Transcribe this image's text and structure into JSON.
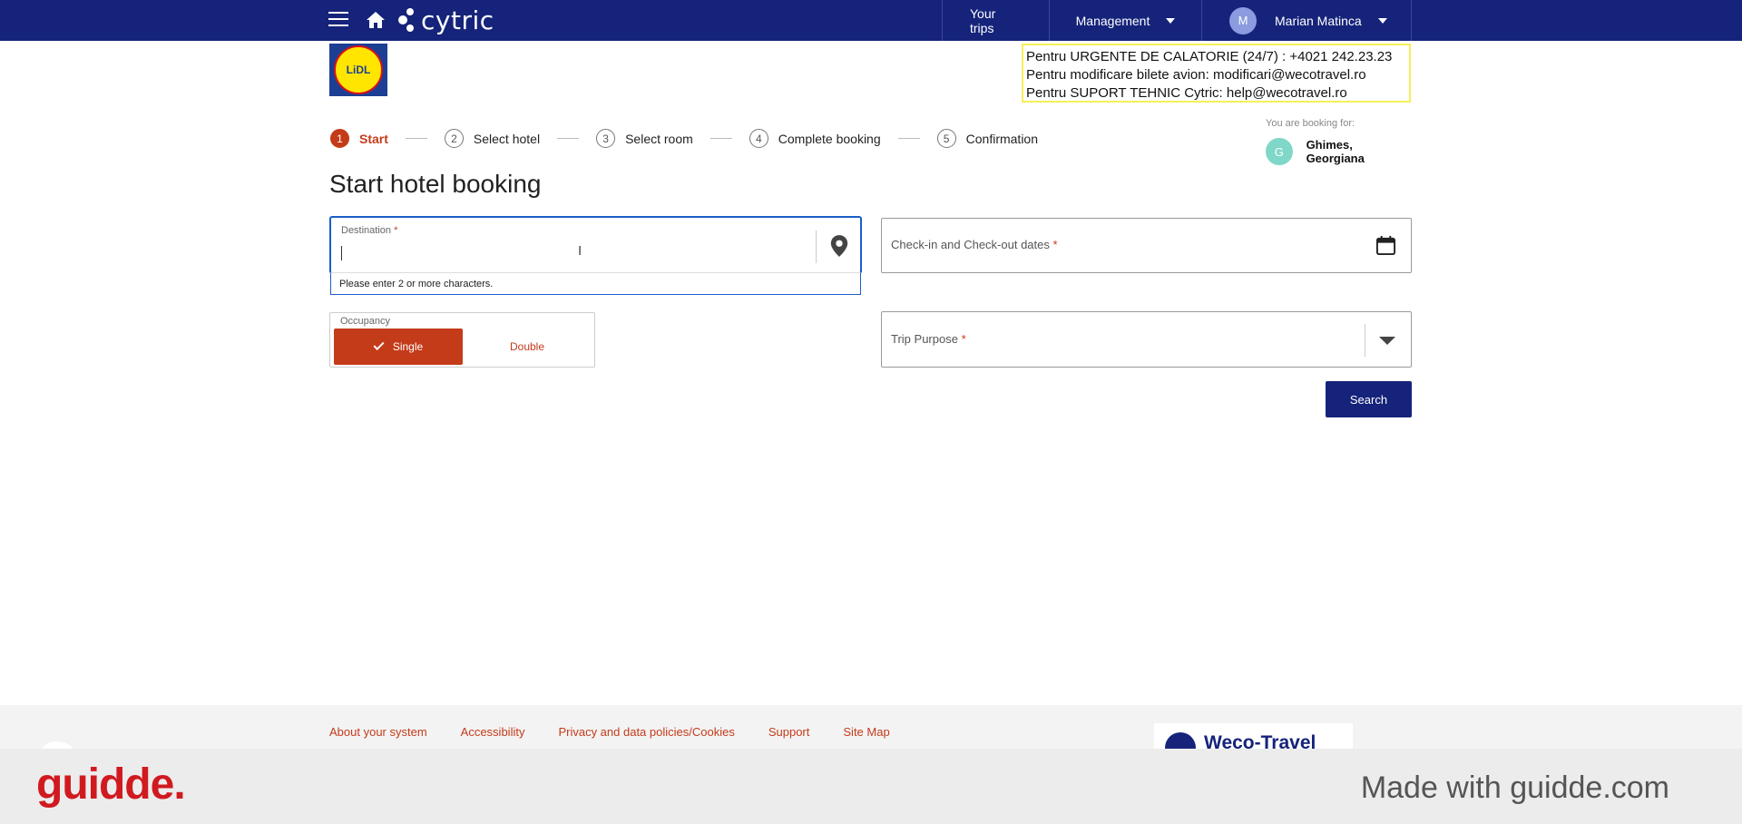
{
  "topbar": {
    "logo_text": "cytric",
    "nav": {
      "your_trips": "Your trips",
      "management": "Management",
      "user_initial": "M",
      "user_name": "Marian Matinca"
    }
  },
  "company_logo_text": "LiDL",
  "emergency": {
    "line1": "Pentru URGENTE DE CALATORIE (24/7) : +4021 242.23.23",
    "line2": "Pentru modificare bilete avion:  modificari@wecotravel.ro",
    "line3": "Pentru SUPORT TEHNIC Cytric:  help@wecotravel.ro"
  },
  "stepper": [
    {
      "num": "1",
      "label": "Start"
    },
    {
      "num": "2",
      "label": "Select hotel"
    },
    {
      "num": "3",
      "label": "Select room"
    },
    {
      "num": "4",
      "label": "Complete booking"
    },
    {
      "num": "5",
      "label": "Confirmation"
    }
  ],
  "booking_for": {
    "caption": "You are booking for:",
    "initial": "G",
    "name": "Ghimes, Georgiana"
  },
  "page_title": "Start hotel booking",
  "form": {
    "destination_label": "Destination",
    "required_mark": "*",
    "destination_value": "",
    "destination_hint": "Please enter 2 or more characters.",
    "occupancy_label": "Occupancy",
    "occupancy_single": "Single",
    "occupancy_double": "Double",
    "occupancy_selected": "Single",
    "dates_placeholder": "Check-in and Check-out dates",
    "purpose_placeholder": "Trip Purpose",
    "search_label": "Search"
  },
  "footer": {
    "links": [
      "About your system",
      "Accessibility",
      "Privacy and data policies/Cookies",
      "Support",
      "Site Map"
    ],
    "partner_logo_text": "Weco-Travel"
  },
  "watermark": {
    "logo": "guidde.",
    "made_with": "Made with guidde.com"
  },
  "colors": {
    "brand_navy": "#15237a",
    "accent_orange": "#c43b1a",
    "focus_blue": "#1a5fc8",
    "emergency_border": "#f7ef59"
  }
}
